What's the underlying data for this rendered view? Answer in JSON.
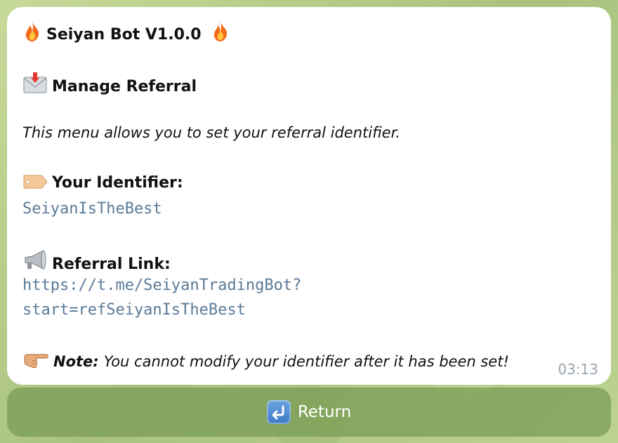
{
  "message": {
    "title": "Seiyan Bot V1.0.0",
    "section_title": "Manage Referral",
    "description": "This menu allows you to set your referral identifier.",
    "identifier_label": "Your Identifier:",
    "identifier_value": "SeiyanIsTheBest",
    "link_label": "Referral Link:",
    "link_line1": "https://t.me/SeiyanTradingBot?",
    "link_line2": "start=refSeiyanIsTheBest",
    "note_label": "Note:",
    "note_text": "You cannot modify your identifier after it has been set!",
    "time": "03:13"
  },
  "icons": {
    "title_left": "fire-icon",
    "title_right": "fire-icon",
    "section": "envelope-icon",
    "identifier": "tag-icon",
    "link": "megaphone-icon",
    "note": "pointing-hand-icon",
    "return": "return-arrow-icon"
  },
  "buttons": {
    "return_label": "Return"
  },
  "colors": {
    "link_mono": "#5b7a98",
    "bubble": "#ffffff",
    "button": "#7a9c54"
  }
}
